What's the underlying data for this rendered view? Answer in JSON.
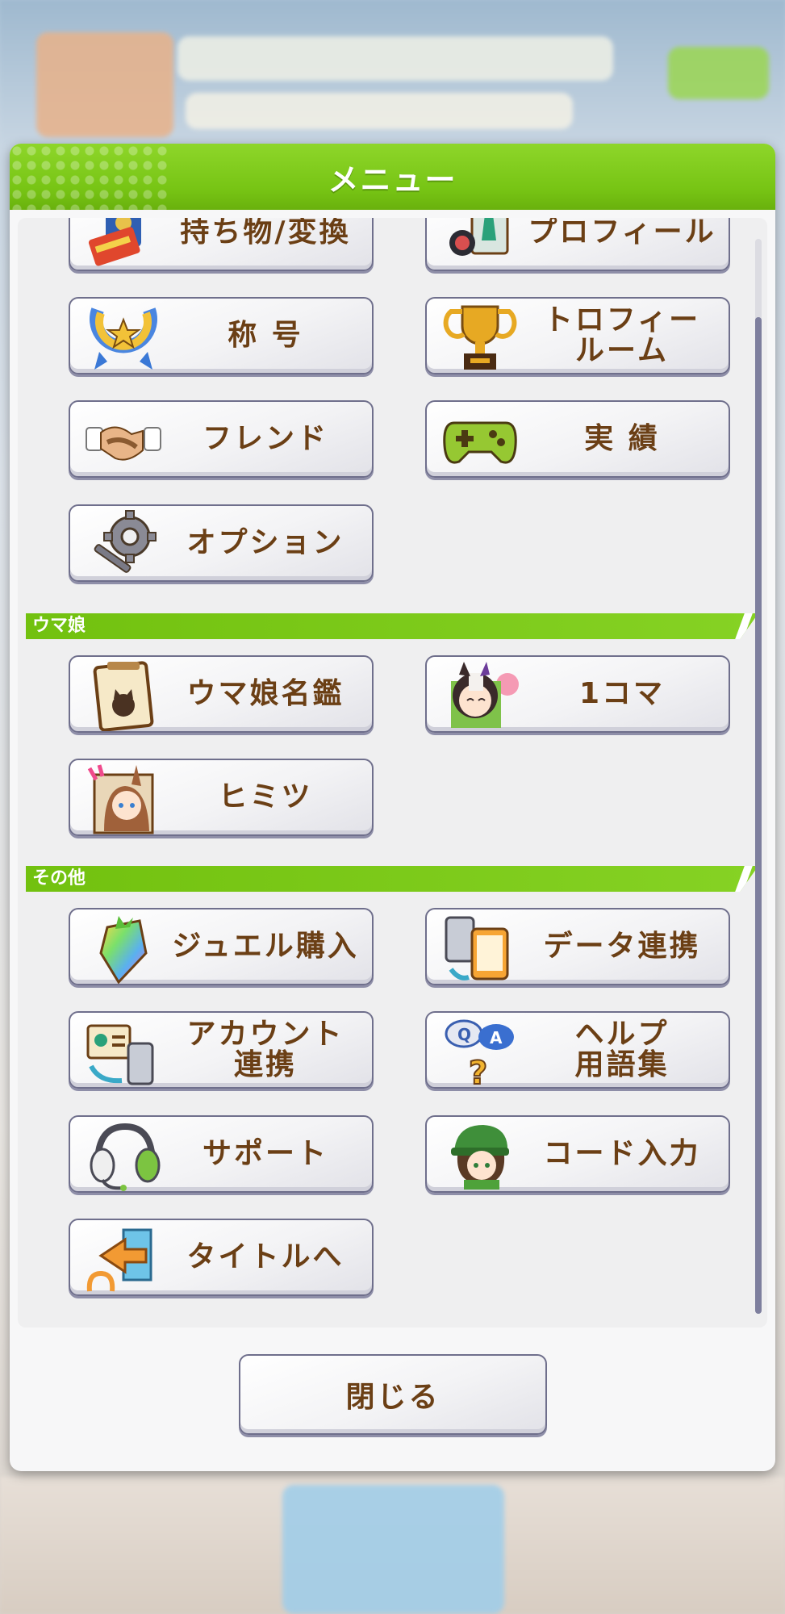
{
  "panel": {
    "title": "メニュー"
  },
  "items_top": [
    {
      "label": "持ち物/変換",
      "icon": "passport-ticket-icon"
    },
    {
      "label": "プロフィール",
      "icon": "profile-card-icon"
    },
    {
      "label": "称 号",
      "icon": "horseshoe-badge-icon"
    },
    {
      "label": "トロフィー\nルーム",
      "icon": "trophy-icon"
    },
    {
      "label": "フレンド",
      "icon": "handshake-icon"
    },
    {
      "label": "実 績",
      "icon": "gamepad-icon"
    },
    {
      "label": "オプション",
      "icon": "gear-wrench-icon"
    }
  ],
  "section_uma": {
    "title": "ウマ娘",
    "items": [
      {
        "label": "ウマ娘名鑑",
        "icon": "clipboard-icon"
      },
      {
        "label": "1コマ",
        "icon": "character-portrait-icon"
      },
      {
        "label": "ヒミツ",
        "icon": "character-secret-icon"
      }
    ]
  },
  "section_other": {
    "title": "その他",
    "items": [
      {
        "label": "ジュエル購入",
        "icon": "jewel-icon"
      },
      {
        "label": "データ連携",
        "icon": "data-link-phones-icon"
      },
      {
        "label": "アカウント\n連携",
        "icon": "account-link-icon"
      },
      {
        "label": "ヘルプ\n用語集",
        "icon": "help-qa-icon"
      },
      {
        "label": "サポート",
        "icon": "headset-icon"
      },
      {
        "label": "コード入力",
        "icon": "character-code-icon"
      },
      {
        "label": "タイトルへ",
        "icon": "exit-door-icon"
      }
    ]
  },
  "close_label": "閉じる"
}
